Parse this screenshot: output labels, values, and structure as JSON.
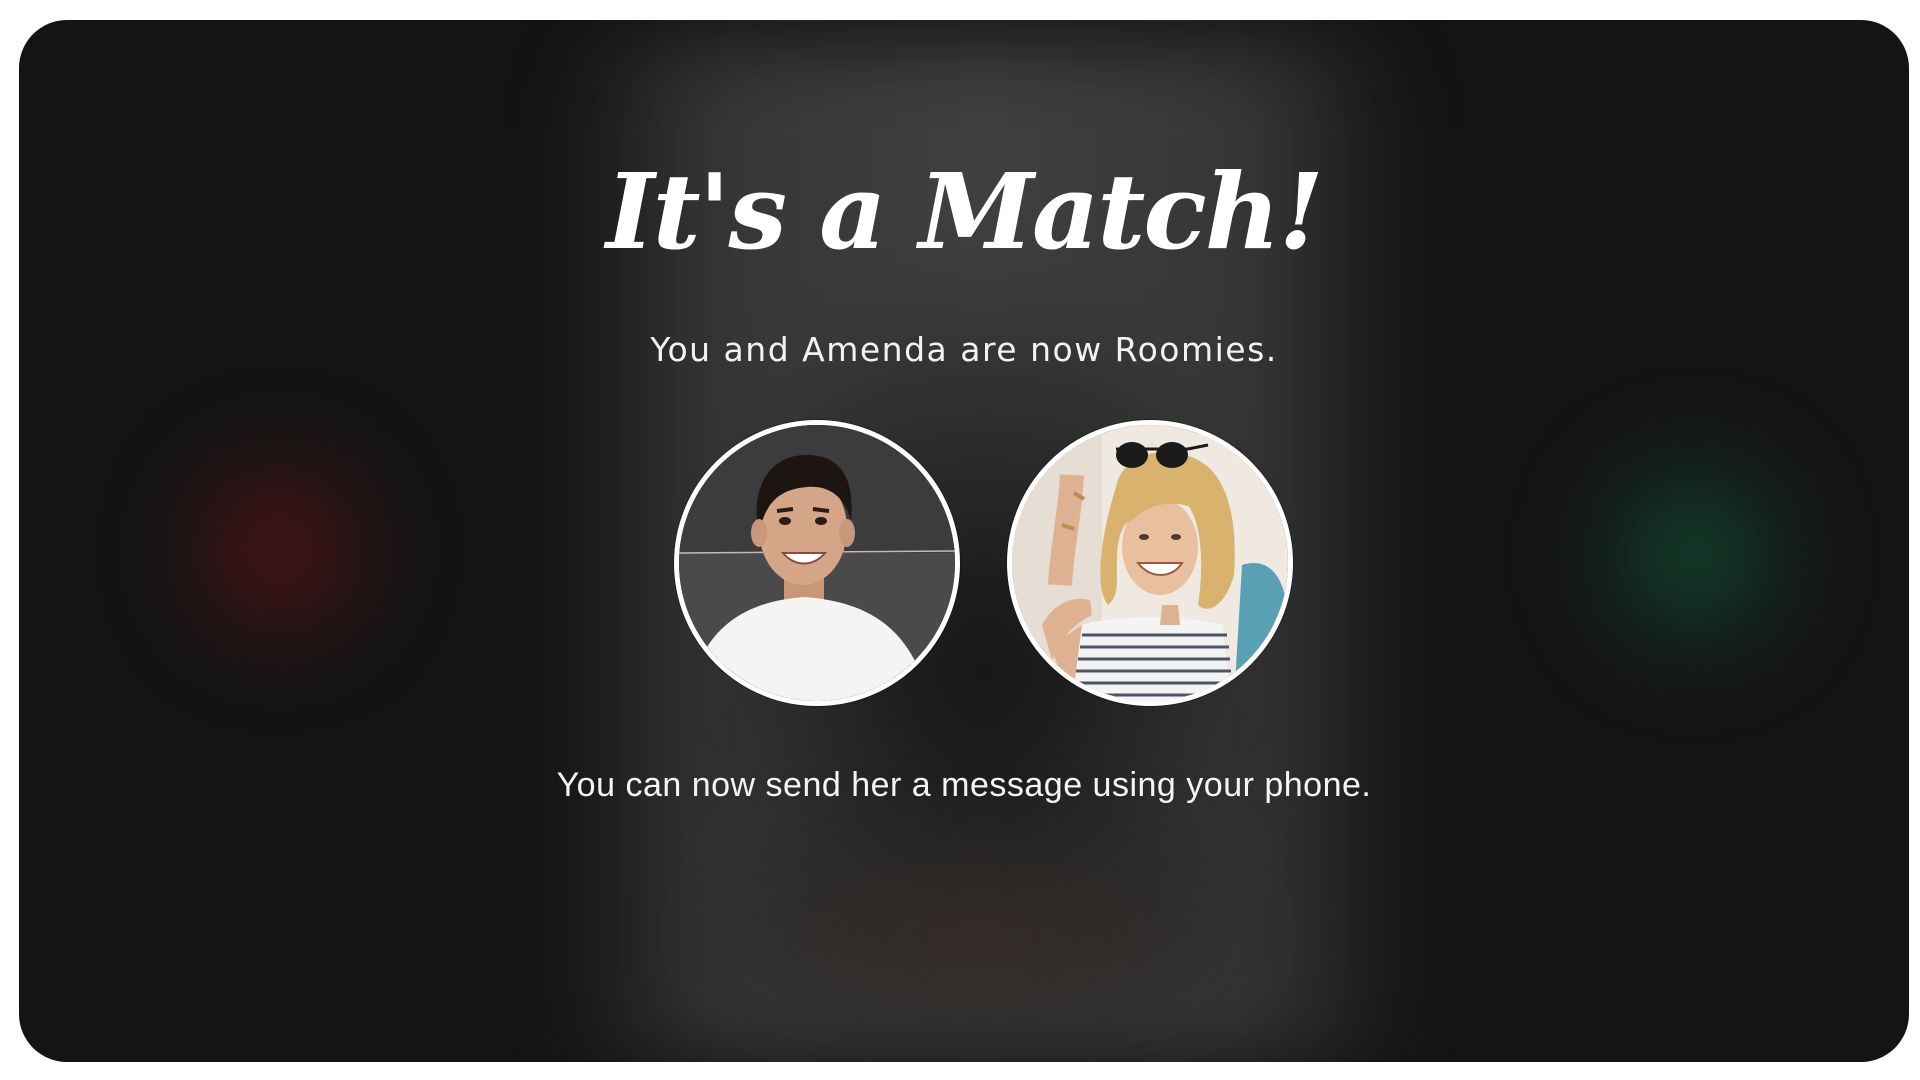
{
  "match": {
    "title": "It's a Match!",
    "subtitle": "You and Amenda are now Roomies.",
    "message": "You can now send her a message using your phone."
  },
  "avatars": [
    {
      "icon": "user-avatar-icon",
      "role": "current-user"
    },
    {
      "icon": "user-avatar-icon",
      "role": "match"
    }
  ],
  "colors": {
    "background": "#141414",
    "card": "#404040",
    "text": "#ffffff",
    "left-glow": "#6e1216",
    "right-glow": "#105a3a"
  }
}
